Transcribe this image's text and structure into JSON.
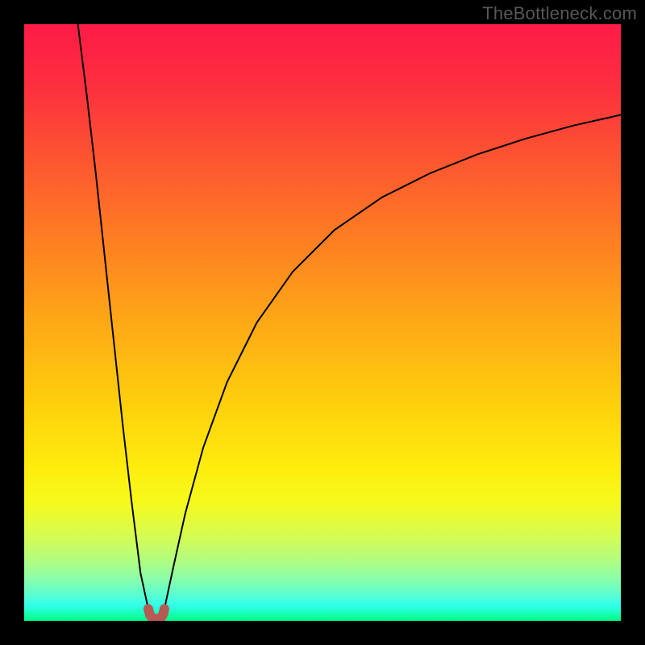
{
  "attribution": "TheBottleneck.com",
  "colors": {
    "frame": "#000000",
    "attribution_text": "#575757",
    "curve_stroke": "#000000",
    "marker_fill": "#b75a53",
    "gradient_stops": [
      {
        "offset": 0.0,
        "color": "#fd1b47"
      },
      {
        "offset": 0.1,
        "color": "#fd2e3f"
      },
      {
        "offset": 0.22,
        "color": "#fd5331"
      },
      {
        "offset": 0.35,
        "color": "#fe7b23"
      },
      {
        "offset": 0.5,
        "color": "#fea816"
      },
      {
        "offset": 0.62,
        "color": "#fecb0d"
      },
      {
        "offset": 0.74,
        "color": "#feec0c"
      },
      {
        "offset": 0.8,
        "color": "#f6fa1b"
      },
      {
        "offset": 0.86,
        "color": "#d4fc53"
      },
      {
        "offset": 0.9,
        "color": "#b0fd82"
      },
      {
        "offset": 0.93,
        "color": "#8afeab"
      },
      {
        "offset": 0.955,
        "color": "#5cfecf"
      },
      {
        "offset": 0.975,
        "color": "#30ffea"
      },
      {
        "offset": 1.0,
        "color": "#00fe83"
      }
    ]
  },
  "chart_data": {
    "type": "line",
    "title": "",
    "xlabel": "",
    "ylabel": "",
    "xlim": [
      0,
      100
    ],
    "ylim": [
      0,
      100
    ],
    "grid": false,
    "series": [
      {
        "name": "left-branch",
        "x": [
          9.0,
          10.5,
          12.0,
          13.5,
          15.0,
          16.5,
          18.0,
          19.5,
          20.8
        ],
        "values": [
          100,
          88.0,
          75.0,
          61.0,
          47.0,
          33.0,
          20.0,
          8.0,
          2.0
        ]
      },
      {
        "name": "right-branch",
        "x": [
          23.5,
          25.0,
          27.0,
          30.0,
          34.0,
          39.0,
          45.0,
          52.0,
          60.0,
          68.0,
          76.0,
          84.0,
          92.0,
          100.0
        ],
        "values": [
          2.0,
          9.0,
          18.0,
          29.0,
          40.0,
          50.0,
          58.5,
          65.5,
          71.0,
          75.0,
          78.2,
          80.8,
          83.0,
          84.8
        ]
      },
      {
        "name": "marker-u",
        "x": [
          20.8,
          21.1,
          21.6,
          22.2,
          22.9,
          23.3,
          23.5
        ],
        "values": [
          2.0,
          0.9,
          0.4,
          0.3,
          0.5,
          1.1,
          2.0
        ]
      }
    ],
    "annotations": []
  }
}
